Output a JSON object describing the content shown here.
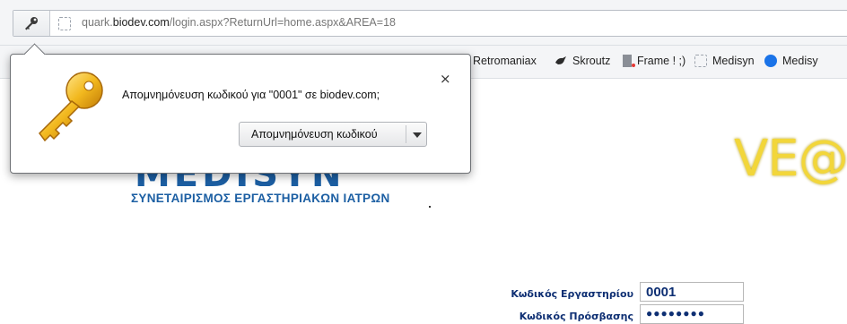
{
  "browser": {
    "url_prefix": "quark.",
    "url_domain": "biodev.com",
    "url_path": "/login.aspx?ReturnUrl=home.aspx&AREA=18"
  },
  "bookmarks": [
    {
      "label": "Retromaniax",
      "icon": "none"
    },
    {
      "label": "Skroutz",
      "icon": "skroutz-bird-icon"
    },
    {
      "label": "Frame ! ;)",
      "icon": "frame-icon"
    },
    {
      "label": "Medisyn",
      "icon": "page-icon"
    },
    {
      "label": "Medisy",
      "icon": "blue-dot-icon"
    }
  ],
  "password_bubble": {
    "message": "Απομνημόνευση κωδικού για \"0001\" σε biodev.com;",
    "close": "×",
    "save_button": "Απομνημόνευση κωδικού"
  },
  "page": {
    "logo_text": "MEDISYN",
    "logo_subtitle": "ΣΥΝΕΤΑΙΡΙΣΜΟΣ ΕΡΓΑΣΤΗΡΙΑΚΩΝ ΙΑΤΡΩΝ",
    "brand_right": "VE@",
    "lab_code_label": "Κωδικός Εργαστηρίου",
    "lab_code_value": "0001",
    "password_label": "Κωδικός Πρόσβασης",
    "password_value": "●●●●●●●●"
  },
  "colors": {
    "brand_blue": "#1c5fa3",
    "label_navy": "#0e2f73",
    "veq_yellow": "#f2d63a"
  }
}
